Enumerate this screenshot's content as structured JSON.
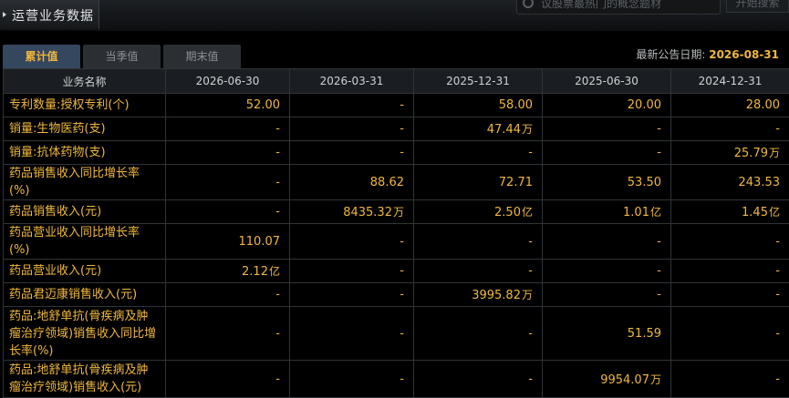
{
  "header": {
    "title": "运营业务数据",
    "search_placeholder": "议股票最热门的概念题材",
    "search_button": "开始搜索"
  },
  "tabs": [
    "累计值",
    "当季值",
    "期末值"
  ],
  "notice": {
    "label": "最新公告日期:",
    "date": "2026-08-31"
  },
  "table": {
    "columns": [
      "业务名称",
      "2026-06-30",
      "2026-03-31",
      "2025-12-31",
      "2025-06-30",
      "2024-12-31"
    ],
    "rows": [
      {
        "name": "专利数量:授权专利(个)",
        "cells": [
          {
            "v": "52.00",
            "u": ""
          },
          {
            "v": "-",
            "u": ""
          },
          {
            "v": "58.00",
            "u": ""
          },
          {
            "v": "20.00",
            "u": ""
          },
          {
            "v": "28.00",
            "u": ""
          }
        ]
      },
      {
        "name": "销量:生物医药(支)",
        "cells": [
          {
            "v": "-",
            "u": ""
          },
          {
            "v": "-",
            "u": ""
          },
          {
            "v": "47.44",
            "u": "万"
          },
          {
            "v": "-",
            "u": ""
          },
          {
            "v": "-",
            "u": ""
          }
        ]
      },
      {
        "name": "销量:抗体药物(支)",
        "cells": [
          {
            "v": "-",
            "u": ""
          },
          {
            "v": "-",
            "u": ""
          },
          {
            "v": "-",
            "u": ""
          },
          {
            "v": "-",
            "u": ""
          },
          {
            "v": "25.79",
            "u": "万"
          }
        ]
      },
      {
        "name": "药品销售收入同比增长率(%)",
        "cells": [
          {
            "v": "-",
            "u": ""
          },
          {
            "v": "88.62",
            "u": ""
          },
          {
            "v": "72.71",
            "u": ""
          },
          {
            "v": "53.50",
            "u": ""
          },
          {
            "v": "243.53",
            "u": ""
          }
        ]
      },
      {
        "name": "药品销售收入(元)",
        "cells": [
          {
            "v": "-",
            "u": ""
          },
          {
            "v": "8435.32",
            "u": "万"
          },
          {
            "v": "2.50",
            "u": "亿"
          },
          {
            "v": "1.01",
            "u": "亿"
          },
          {
            "v": "1.45",
            "u": "亿"
          }
        ]
      },
      {
        "name": "药品营业收入同比增长率(%)",
        "cells": [
          {
            "v": "110.07",
            "u": ""
          },
          {
            "v": "-",
            "u": ""
          },
          {
            "v": "-",
            "u": ""
          },
          {
            "v": "-",
            "u": ""
          },
          {
            "v": "-",
            "u": ""
          }
        ]
      },
      {
        "name": "药品营业收入(元)",
        "cells": [
          {
            "v": "2.12",
            "u": "亿"
          },
          {
            "v": "-",
            "u": ""
          },
          {
            "v": "-",
            "u": ""
          },
          {
            "v": "-",
            "u": ""
          },
          {
            "v": "-",
            "u": ""
          }
        ]
      },
      {
        "name": "药品君迈康销售收入(元)",
        "cells": [
          {
            "v": "-",
            "u": ""
          },
          {
            "v": "-",
            "u": ""
          },
          {
            "v": "3995.82",
            "u": "万"
          },
          {
            "v": "-",
            "u": ""
          },
          {
            "v": "-",
            "u": ""
          }
        ]
      },
      {
        "name": "药品:地舒单抗(骨疾病及肿瘤治疗领域)销售收入同比增长率(%)",
        "cells": [
          {
            "v": "-",
            "u": ""
          },
          {
            "v": "-",
            "u": ""
          },
          {
            "v": "-",
            "u": ""
          },
          {
            "v": "51.59",
            "u": ""
          },
          {
            "v": "-",
            "u": ""
          }
        ]
      },
      {
        "name": "药品:地舒单抗(骨疾病及肿瘤治疗领域)销售收入(元)",
        "cells": [
          {
            "v": "-",
            "u": ""
          },
          {
            "v": "-",
            "u": ""
          },
          {
            "v": "-",
            "u": ""
          },
          {
            "v": "9954.07",
            "u": "万"
          },
          {
            "v": "-",
            "u": ""
          }
        ]
      }
    ]
  }
}
